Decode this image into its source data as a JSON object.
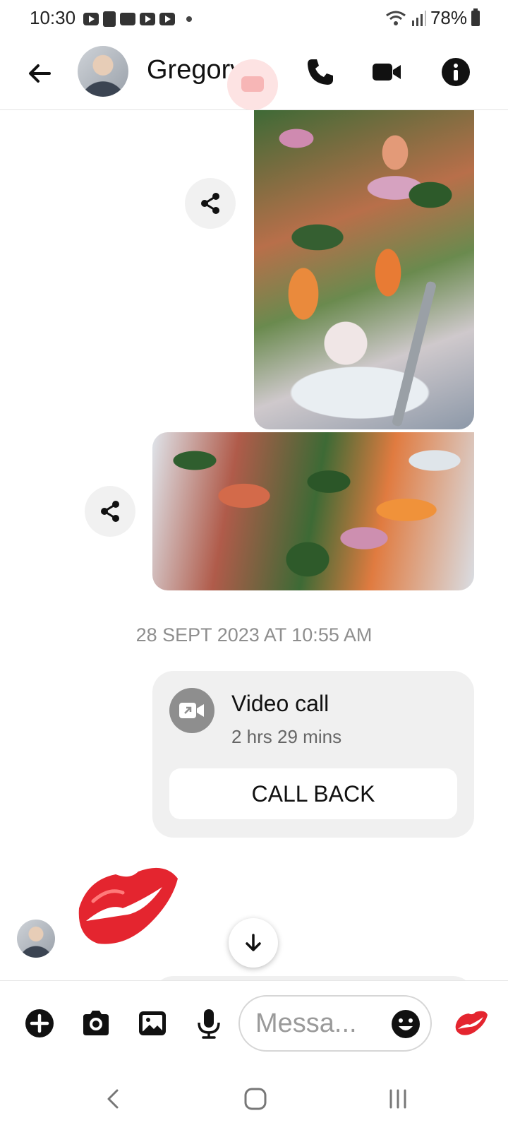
{
  "status_bar": {
    "time": "10:30",
    "battery": "78%",
    "left_icons": [
      "youtube-icon",
      "shop-icon",
      "folder-icon",
      "youtube-icon",
      "youtube-icon"
    ],
    "right_icons": [
      "wifi-icon",
      "signal-icon",
      "battery-icon"
    ]
  },
  "header": {
    "contact_name": "Gregory",
    "icons": [
      "back-arrow-icon",
      "phone-icon",
      "video-camera-icon",
      "info-icon"
    ]
  },
  "messages": {
    "shared_images": [
      {
        "description_icon": "share-icon"
      },
      {
        "description_icon": "share-icon"
      }
    ],
    "timestamp": "28 SEPT 2023 AT 10:55 AM",
    "call_card": {
      "title": "Video call",
      "duration": "2 hrs 29 mins",
      "button_label": "CALL BACK"
    },
    "reaction_emoji": "kiss-mark"
  },
  "composer": {
    "placeholder": "Messa...",
    "icons": [
      "plus-icon",
      "camera-icon",
      "gallery-icon",
      "microphone-icon",
      "emoji-icon",
      "kiss-mark-icon"
    ]
  },
  "colors": {
    "accent": "#000000",
    "kiss_red": "#e4252f",
    "card_bg": "#f0f0f0",
    "timestamp_gray": "#8e8e8e"
  }
}
